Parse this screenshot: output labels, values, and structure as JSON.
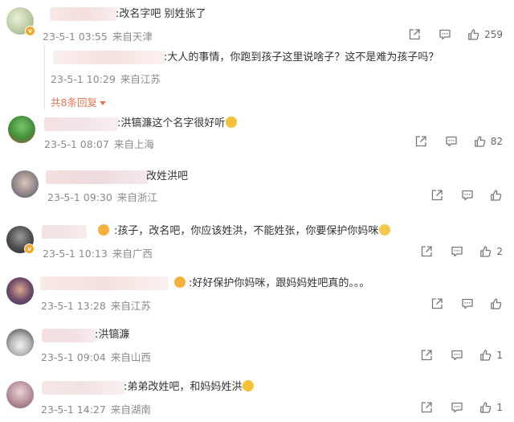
{
  "comments": [
    {
      "text": ":改名字吧  别姓张了",
      "date": "23-5-1 03:55",
      "location": "来自天津",
      "likes": "259",
      "reply": {
        "text": ":大人的事情，你跑到孩子这里说啥子？这不是难为孩子吗？",
        "date": "23-5-1 10:29",
        "location": "来自江苏"
      },
      "more_replies": "共8条回复"
    },
    {
      "text": ":洪镐濂这个名字很好听",
      "date": "23-5-1 08:07",
      "location": "来自上海",
      "likes": "82"
    },
    {
      "text": "改姓洪吧",
      "date": "23-5-1 09:30",
      "location": "来自浙江",
      "likes": ""
    },
    {
      "text": ":孩子，改名吧，你应该姓洪，不能姓张，你要保护你妈咪",
      "date": "23-5-1 10:13",
      "location": "来自广西",
      "likes": "2"
    },
    {
      "text": ":好好保护你妈咪，跟妈妈姓吧真的。。。",
      "date": "23-5-1 13:28",
      "location": "来自江苏",
      "likes": ""
    },
    {
      "text": ":洪镐濂",
      "date": "23-5-1 09:04",
      "location": "来自山西",
      "likes": "1"
    },
    {
      "text": ":弟弟改姓吧，和妈妈姓洪",
      "date": "23-5-1 14:27",
      "location": "来自湖南",
      "likes": "1"
    }
  ],
  "icons": {
    "share": "share-icon",
    "comment": "comment-icon",
    "like": "thumbs-up-icon"
  },
  "colors": {
    "accent": "#eb7350",
    "meta": "#8a8a8a"
  }
}
